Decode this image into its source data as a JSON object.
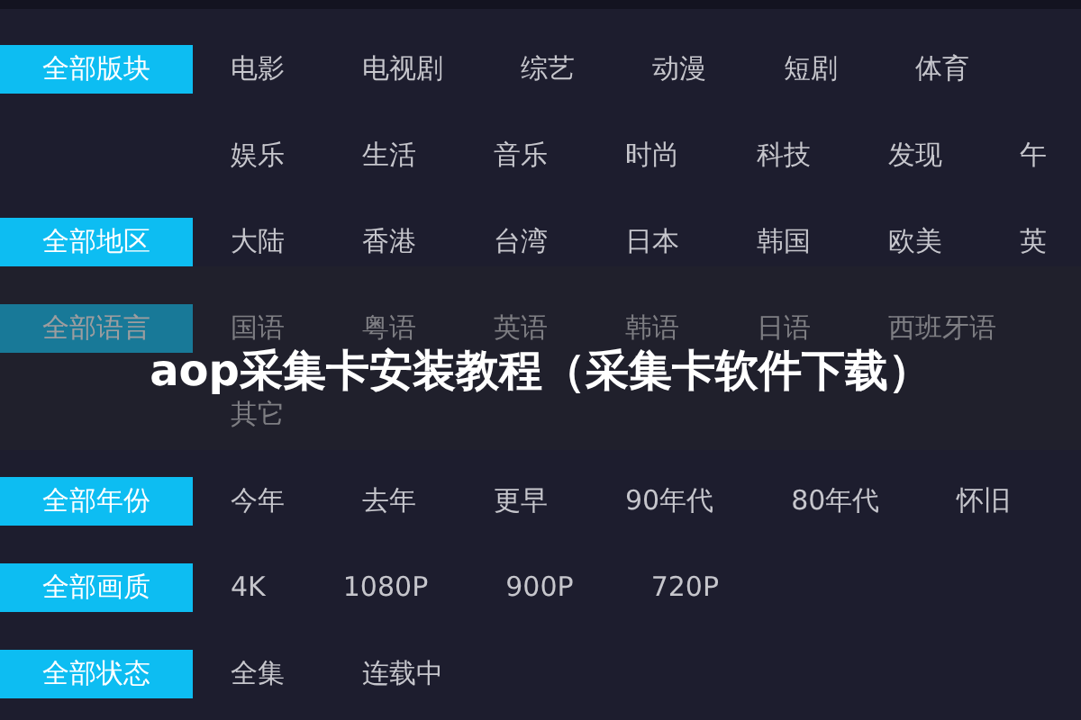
{
  "sections": [
    {
      "all": {
        "label": "全部版块",
        "selected": true
      },
      "lines": [
        [
          {
            "label": "电影",
            "selected": false
          },
          {
            "label": "电视剧",
            "selected": false
          },
          {
            "label": "综艺",
            "selected": false
          },
          {
            "label": "动漫",
            "selected": false
          },
          {
            "label": "短剧",
            "selected": false
          },
          {
            "label": "体育",
            "selected": false
          }
        ],
        [
          {
            "label": "娱乐",
            "selected": false
          },
          {
            "label": "生活",
            "selected": false
          },
          {
            "label": "音乐",
            "selected": false
          },
          {
            "label": "时尚",
            "selected": false
          },
          {
            "label": "科技",
            "selected": false
          },
          {
            "label": "发现",
            "selected": false
          },
          {
            "label": "午",
            "selected": false
          }
        ]
      ]
    },
    {
      "all": {
        "label": "全部地区",
        "selected": true
      },
      "lines": [
        [
          {
            "label": "大陆",
            "selected": false
          },
          {
            "label": "香港",
            "selected": false
          },
          {
            "label": "台湾",
            "selected": false
          },
          {
            "label": "日本",
            "selected": false
          },
          {
            "label": "韩国",
            "selected": false
          },
          {
            "label": "欧美",
            "selected": false
          },
          {
            "label": "英",
            "selected": false
          }
        ]
      ]
    },
    {
      "all": {
        "label": "全部语言",
        "selected": true
      },
      "lines": [
        [
          {
            "label": "国语",
            "selected": false
          },
          {
            "label": "粤语",
            "selected": false
          },
          {
            "label": "英语",
            "selected": false
          },
          {
            "label": "韩语",
            "selected": false
          },
          {
            "label": "日语",
            "selected": false
          },
          {
            "label": "西班牙语",
            "selected": false
          }
        ],
        [
          {
            "label": "其它",
            "selected": false
          }
        ]
      ]
    },
    {
      "all": {
        "label": "全部年份",
        "selected": true
      },
      "lines": [
        [
          {
            "label": "今年",
            "selected": false
          },
          {
            "label": "去年",
            "selected": false
          },
          {
            "label": "更早",
            "selected": false
          },
          {
            "label": "90年代",
            "selected": false
          },
          {
            "label": "80年代",
            "selected": false
          },
          {
            "label": "怀旧",
            "selected": false
          }
        ]
      ]
    },
    {
      "all": {
        "label": "全部画质",
        "selected": true
      },
      "lines": [
        [
          {
            "label": "4K",
            "selected": false
          },
          {
            "label": "1080P",
            "selected": false
          },
          {
            "label": "900P",
            "selected": false
          },
          {
            "label": "720P",
            "selected": false
          }
        ]
      ]
    },
    {
      "all": {
        "label": "全部状态",
        "selected": true
      },
      "lines": [
        [
          {
            "label": "全集",
            "selected": false
          },
          {
            "label": "连载中",
            "selected": false
          }
        ]
      ]
    }
  ],
  "banner": {
    "title": "aop采集卡安装教程（采集卡软件下载）"
  }
}
